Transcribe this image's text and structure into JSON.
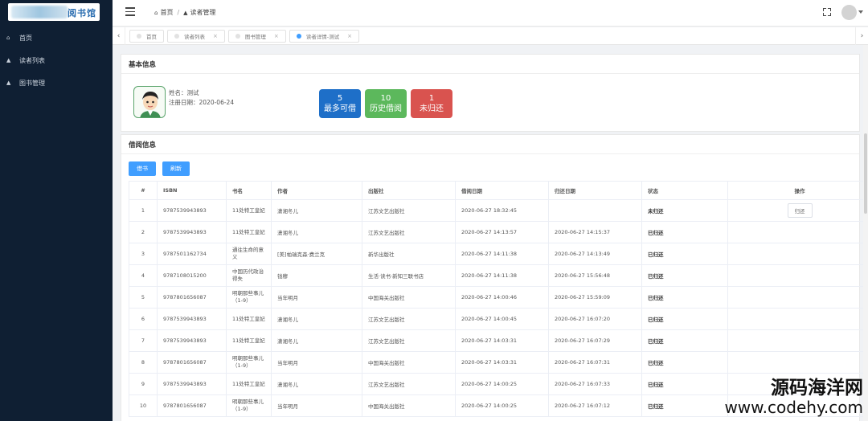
{
  "logo": {
    "text": "阅书馆"
  },
  "sidebar": {
    "items": [
      {
        "label": "首页"
      },
      {
        "label": "读者列表"
      },
      {
        "label": "图书管理"
      }
    ]
  },
  "header": {
    "breadcrumb_home": "首页",
    "breadcrumb_sep": "/",
    "breadcrumb_current": "读者管理"
  },
  "tabs": [
    {
      "label": "首页",
      "active": false,
      "closable": false
    },
    {
      "label": "读者列表",
      "active": false,
      "closable": true
    },
    {
      "label": "图书管理",
      "active": false,
      "closable": true
    },
    {
      "label": "读者详情-测试",
      "active": true,
      "closable": true
    }
  ],
  "basic_info": {
    "title": "基本信息",
    "name_line": "姓名：测试",
    "register_line": "注册日期：2020-06-24",
    "stats": [
      {
        "num": "5",
        "label": "最多可借",
        "color": "#1e6fc8"
      },
      {
        "num": "10",
        "label": "历史借阅",
        "color": "#5cb85c"
      },
      {
        "num": "1",
        "label": "未归还",
        "color": "#d9534f"
      }
    ]
  },
  "borrow_info": {
    "title": "借阅信息",
    "borrow_button": "借书",
    "refresh_button": "刷新",
    "columns": [
      "#",
      "ISBN",
      "书名",
      "作者",
      "出版社",
      "借阅日期",
      "归还日期",
      "状态",
      "操作"
    ],
    "rows": [
      [
        "1",
        "9787539943893",
        "11处特工皇妃",
        "潇湘冬儿",
        "江苏文艺出版社",
        "2020-06-27 18:32:45",
        "",
        "未归还",
        "归还"
      ],
      [
        "2",
        "9787539943893",
        "11处特工皇妃",
        "潇湘冬儿",
        "江苏文艺出版社",
        "2020-06-27 14:13:57",
        "2020-06-27 14:15:37",
        "已归还",
        ""
      ],
      [
        "3",
        "9787501162734",
        "通往生命的意义",
        "[美]帕瑞克森·费兰克",
        "新华出版社",
        "2020-06-27 14:11:38",
        "2020-06-27 14:13:49",
        "已归还",
        ""
      ],
      [
        "4",
        "9787108015200",
        "中国历代政治得失",
        "钱穆",
        "生活·读书·新知三联书店",
        "2020-06-27 14:11:38",
        "2020-06-27 15:56:48",
        "已归还",
        ""
      ],
      [
        "5",
        "9787801656087",
        "明朝那些事儿（1-9）",
        "当年明月",
        "中国海关出版社",
        "2020-06-27 14:00:46",
        "2020-06-27 15:59:09",
        "已归还",
        ""
      ],
      [
        "6",
        "9787539943893",
        "11处特工皇妃",
        "潇湘冬儿",
        "江苏文艺出版社",
        "2020-06-27 14:00:45",
        "2020-06-27 16:07:20",
        "已归还",
        ""
      ],
      [
        "7",
        "9787539943893",
        "11处特工皇妃",
        "潇湘冬儿",
        "江苏文艺出版社",
        "2020-06-27 14:03:31",
        "2020-06-27 16:07:29",
        "已归还",
        ""
      ],
      [
        "8",
        "9787801656087",
        "明朝那些事儿（1-9）",
        "当年明月",
        "中国海关出版社",
        "2020-06-27 14:03:31",
        "2020-06-27 16:07:31",
        "已归还",
        ""
      ],
      [
        "9",
        "9787539943893",
        "11处特工皇妃",
        "潇湘冬儿",
        "江苏文艺出版社",
        "2020-06-27 14:00:25",
        "2020-06-27 16:07:33",
        "已归还",
        ""
      ],
      [
        "10",
        "9787801656087",
        "明朝那些事儿（1-9）",
        "当年明月",
        "中国海关出版社",
        "2020-06-27 14:00:25",
        "2020-06-27 16:07:12",
        "已归还",
        ""
      ]
    ]
  },
  "watermark": {
    "line1": "源码海洋网",
    "line2": "www.codehy.com"
  }
}
